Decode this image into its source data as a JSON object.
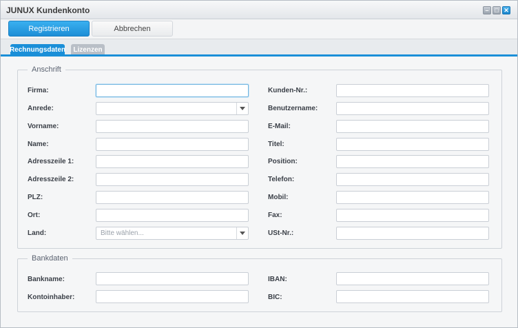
{
  "window": {
    "title": "JUNUX Kundenkonto",
    "controls": [
      "minimize-icon",
      "maximize-icon",
      "close-icon"
    ],
    "accent_color": "#1a8fd8"
  },
  "toolbar": {
    "register_label": "Registrieren",
    "cancel_label": "Abbrechen"
  },
  "tabs": [
    {
      "label": "Rechnungsdaten",
      "active": true
    },
    {
      "label": "Lizenzen",
      "active": false
    }
  ],
  "anschrift": {
    "legend": "Anschrift",
    "left": {
      "firma": "Firma:",
      "anrede": "Anrede:",
      "vorname": "Vorname:",
      "name": "Name:",
      "adresse1": "Adresszeile 1:",
      "adresse2": "Adresszeile 2:",
      "plz": "PLZ:",
      "ort": "Ort:",
      "land": "Land:"
    },
    "right": {
      "kundennr": "Kunden-Nr.:",
      "benutzername": "Benutzername:",
      "email": "E-Mail:",
      "titel": "Titel:",
      "position": "Position:",
      "telefon": "Telefon:",
      "mobil": "Mobil:",
      "fax": "Fax:",
      "ustnr": "USt-Nr.:"
    },
    "land_placeholder": "Bitte wählen..."
  },
  "bankdaten": {
    "legend": "Bankdaten",
    "bankname": "Bankname:",
    "kontoinhaber": "Kontoinhaber:",
    "iban": "IBAN:",
    "bic": "BIC:"
  }
}
